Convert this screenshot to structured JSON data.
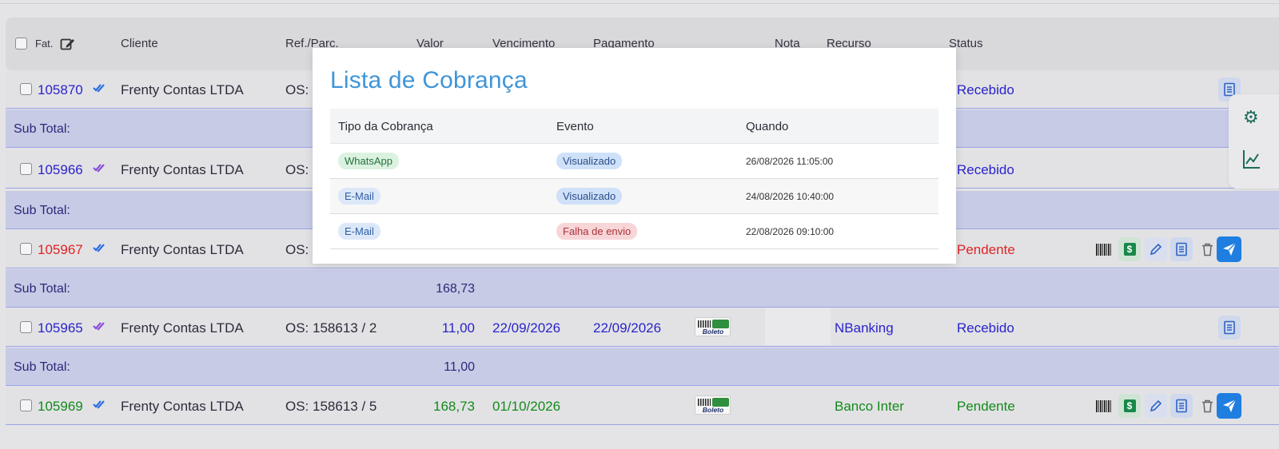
{
  "header": {
    "fat": "Fat.",
    "cliente": "Cliente",
    "ref": "Ref./Parc.",
    "valor": "Valor",
    "vencimento": "Vencimento",
    "pagamento": "Pagamento",
    "nota": "Nota",
    "recurso": "Recurso",
    "status": "Status"
  },
  "rows": [
    {
      "num": "105870",
      "cliente": "Frenty Contas LTDA",
      "ref": "OS:",
      "valor": "",
      "vencimento": "",
      "pagamento": "",
      "recurso": "",
      "status": "Recebido"
    },
    {
      "num": "105966",
      "cliente": "Frenty Contas LTDA",
      "ref": "OS:",
      "valor": "",
      "vencimento": "",
      "pagamento": "",
      "recurso": "",
      "status": "Recebido"
    },
    {
      "num": "105967",
      "cliente": "Frenty Contas LTDA",
      "ref": "OS:",
      "valor": "",
      "vencimento": "",
      "pagamento": "",
      "recurso": "",
      "status": "Pendente"
    },
    {
      "num": "105965",
      "cliente": "Frenty Contas LTDA",
      "ref": "OS: 158613 / 2",
      "valor": "11,00",
      "vencimento": "22/09/2026",
      "pagamento": "22/09/2026",
      "recurso": "NBanking",
      "status": "Recebido"
    },
    {
      "num": "105969",
      "cliente": "Frenty Contas LTDA",
      "ref": "OS: 158613 / 5",
      "valor": "168,73",
      "vencimento": "01/10/2026",
      "pagamento": "",
      "recurso": "Banco Inter",
      "status": "Pendente"
    }
  ],
  "subtotals": [
    {
      "label": "Sub Total:",
      "value": ""
    },
    {
      "label": "Sub Total:",
      "value": ""
    },
    {
      "label": "Sub Total:",
      "value": "168,73"
    },
    {
      "label": "Sub Total:",
      "value": "11,00"
    }
  ],
  "boleto_text": "Boleto",
  "modal": {
    "title": "Lista de Cobrança",
    "columns": [
      "Tipo da Cobrança",
      "Evento",
      "Quando"
    ],
    "items": [
      {
        "tipo": "WhatsApp",
        "evento": "Visualizado",
        "quando": "26/08/2026 11:05:00"
      },
      {
        "tipo": "E-Mail",
        "evento": "Visualizado",
        "quando": "24/08/2026 10:40:00"
      },
      {
        "tipo": "E-Mail",
        "evento": "Falha de envio",
        "quando": "22/08/2026 09:10:00"
      }
    ]
  },
  "icons": {
    "edit": "edit-icon",
    "check": "double-check-icon",
    "barcode": "barcode-icon",
    "money": "dollar-icon",
    "pencil": "pencil-icon",
    "receipt": "receipt-icon",
    "trash": "trash-icon",
    "send": "send-icon"
  },
  "colors": {
    "accent": "#3f95d8",
    "link_blue": "#2a23c9",
    "pending_red": "#e02424",
    "ok_green": "#138a1a",
    "check_blue": "#2c6fe0",
    "check_purple": "#8a4fd8"
  }
}
